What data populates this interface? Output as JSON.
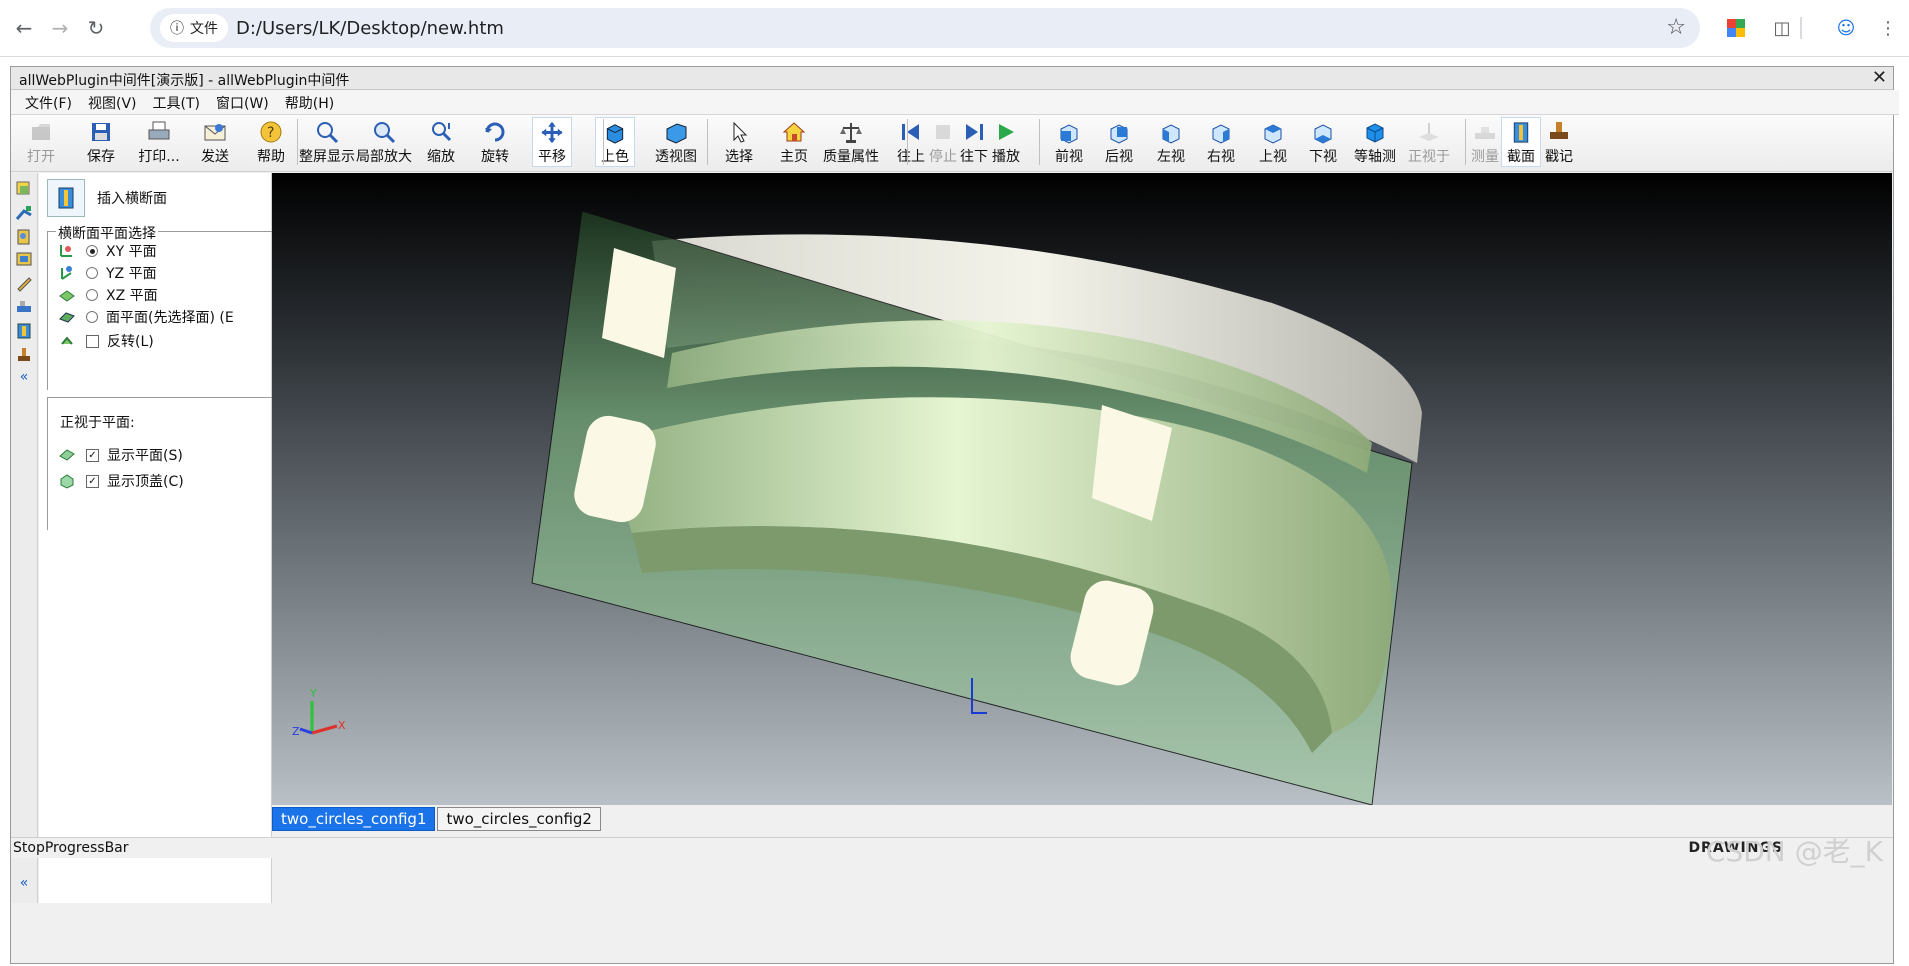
{
  "browser": {
    "site_chip_label": "文件",
    "url": "D:/Users/LK/Desktop/new.htm"
  },
  "app": {
    "title": "allWebPlugin中间件[演示版] - allWebPlugin中间件",
    "menu": [
      "文件(F)",
      "视图(V)",
      "工具(T)",
      "窗口(W)",
      "帮助(H)"
    ]
  },
  "toolbar": {
    "buttons": [
      {
        "label": "打开",
        "icon": "open-icon",
        "enabled": false
      },
      {
        "label": "保存",
        "icon": "save-icon",
        "enabled": true
      },
      {
        "label": "打印...",
        "icon": "print-icon",
        "enabled": true
      },
      {
        "label": "发送",
        "icon": "send-icon",
        "enabled": true
      },
      {
        "label": "帮助",
        "icon": "help-icon",
        "enabled": true
      },
      {
        "label": "整屏显示",
        "icon": "zoom-fit-icon",
        "enabled": true
      },
      {
        "label": "局部放大",
        "icon": "zoom-area-icon",
        "enabled": true
      },
      {
        "label": "缩放",
        "icon": "zoom-icon",
        "enabled": true
      },
      {
        "label": "旋转",
        "icon": "rotate-icon",
        "enabled": true
      },
      {
        "label": "平移",
        "icon": "pan-icon",
        "enabled": true
      },
      {
        "label": "上色",
        "icon": "shaded-icon",
        "enabled": true
      },
      {
        "label": "透视图",
        "icon": "perspective-icon",
        "enabled": true
      },
      {
        "label": "选择",
        "icon": "select-icon",
        "enabled": true
      },
      {
        "label": "主页",
        "icon": "home-icon",
        "enabled": true
      },
      {
        "label": "质量属性",
        "icon": "mass-properties-icon",
        "enabled": true
      },
      {
        "label": "往上",
        "icon": "previous-icon",
        "enabled": true
      },
      {
        "label": "停止",
        "icon": "stop-icon",
        "enabled": false
      },
      {
        "label": "往下",
        "icon": "next-icon",
        "enabled": true
      },
      {
        "label": "播放",
        "icon": "play-icon",
        "enabled": true
      },
      {
        "label": "前视",
        "icon": "front-view-icon",
        "enabled": true
      },
      {
        "label": "后视",
        "icon": "back-view-icon",
        "enabled": true
      },
      {
        "label": "左视",
        "icon": "left-view-icon",
        "enabled": true
      },
      {
        "label": "右视",
        "icon": "right-view-icon",
        "enabled": true
      },
      {
        "label": "上视",
        "icon": "top-view-icon",
        "enabled": true
      },
      {
        "label": "下视",
        "icon": "bottom-view-icon",
        "enabled": true
      },
      {
        "label": "等轴测",
        "icon": "isometric-icon",
        "enabled": true
      },
      {
        "label": "正视于",
        "icon": "normal-to-icon",
        "enabled": false
      },
      {
        "label": "测量",
        "icon": "measure-icon",
        "enabled": false
      },
      {
        "label": "截面",
        "icon": "section-icon",
        "enabled": true
      },
      {
        "label": "戳记",
        "icon": "stamp-icon",
        "enabled": true
      }
    ]
  },
  "panel": {
    "title": "插入横断面",
    "group_title": "横断面平面选择",
    "options": [
      {
        "label": "XY 平面",
        "selected": true
      },
      {
        "label": "YZ 平面",
        "selected": false
      },
      {
        "label": "XZ 平面",
        "selected": false
      },
      {
        "label": "面平面(先选择面) (E",
        "selected": false
      }
    ],
    "flip_label": "反转(L)",
    "normal_title": "正视于平面:",
    "show_plane_label": "显示平面(S)",
    "show_cap_label": "显示顶盖(C)"
  },
  "viewport": {
    "triad": {
      "x": "X",
      "y": "Y",
      "z": "Z"
    }
  },
  "tabs": [
    "two_circles_config1",
    "two_circles_config2"
  ],
  "status": {
    "text": "StopProgressBar",
    "brand": "DRAWINGS",
    "watermark": "CSDN @老_K"
  },
  "colors": {
    "active_tab": "#1a73e8",
    "section_plane": "#8fb896",
    "part_body": "#cfe3c0"
  }
}
